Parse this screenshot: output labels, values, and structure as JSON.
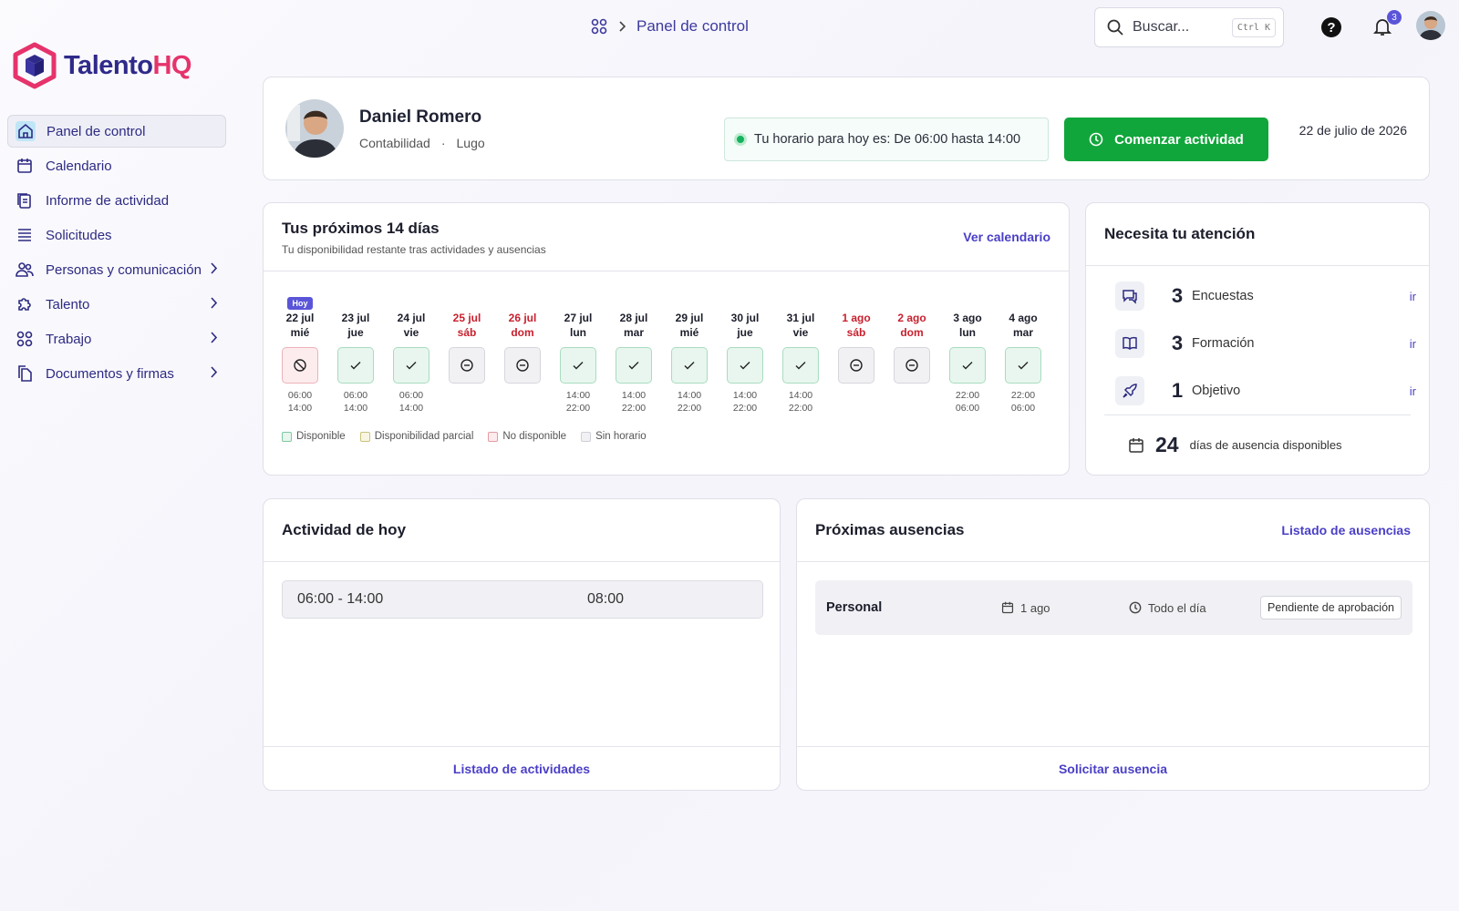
{
  "app": {
    "brand_part1": "Talento",
    "brand_part2": "HQ",
    "brand_color_primary": "#2f2a8a",
    "brand_color_accent": "#e6336b"
  },
  "header": {
    "breadcrumb_icon": "apps-grid-icon",
    "breadcrumb": "Panel de control",
    "search_placeholder": "Buscar...",
    "search_shortcut": "Ctrl K",
    "notifications_count": "3"
  },
  "sidebar": {
    "items": [
      {
        "label": "Panel de control",
        "icon": "home-icon",
        "active": true
      },
      {
        "label": "Calendario",
        "icon": "calendar-icon"
      },
      {
        "label": "Informe de actividad",
        "icon": "report-icon"
      },
      {
        "label": "Solicitudes",
        "icon": "list-icon"
      },
      {
        "label": "Personas y comunicación",
        "icon": "people-icon",
        "expandable": true
      },
      {
        "label": "Talento",
        "icon": "puzzle-icon",
        "expandable": true
      },
      {
        "label": "Trabajo",
        "icon": "grid-icon",
        "expandable": true
      },
      {
        "label": "Documentos y firmas",
        "icon": "documents-icon",
        "expandable": true
      }
    ]
  },
  "profile": {
    "name": "Daniel Romero",
    "department": "Contabilidad",
    "separator": "·",
    "location": "Lugo",
    "schedule_text": "Tu horario para hoy es: De 06:00 hasta 14:00",
    "start_button": "Comenzar actividad",
    "date": "22 de julio de 2026"
  },
  "days": {
    "title": "Tus próximos 14 días",
    "subtitle": "Tu disponibilidad restante tras actividades y ausencias",
    "link": "Ver calendario",
    "today_badge": "Hoy",
    "list": [
      {
        "date": "22 jul",
        "dow": "mié",
        "status": "no",
        "start": "06:00",
        "end": "14:00",
        "today": true
      },
      {
        "date": "23 jul",
        "dow": "jue",
        "status": "ok",
        "start": "06:00",
        "end": "14:00"
      },
      {
        "date": "24 jul",
        "dow": "vie",
        "status": "ok",
        "start": "06:00",
        "end": "14:00"
      },
      {
        "date": "25 jul",
        "dow": "sáb",
        "status": "none",
        "weekend": true
      },
      {
        "date": "26 jul",
        "dow": "dom",
        "status": "none",
        "weekend": true
      },
      {
        "date": "27 jul",
        "dow": "lun",
        "status": "ok",
        "start": "14:00",
        "end": "22:00"
      },
      {
        "date": "28 jul",
        "dow": "mar",
        "status": "ok",
        "start": "14:00",
        "end": "22:00"
      },
      {
        "date": "29 jul",
        "dow": "mié",
        "status": "ok",
        "start": "14:00",
        "end": "22:00"
      },
      {
        "date": "30 jul",
        "dow": "jue",
        "status": "ok",
        "start": "14:00",
        "end": "22:00"
      },
      {
        "date": "31 jul",
        "dow": "vie",
        "status": "ok",
        "start": "14:00",
        "end": "22:00"
      },
      {
        "date": "1 ago",
        "dow": "sáb",
        "status": "none",
        "weekend": true
      },
      {
        "date": "2 ago",
        "dow": "dom",
        "status": "none",
        "weekend": true
      },
      {
        "date": "3 ago",
        "dow": "lun",
        "status": "ok",
        "start": "22:00",
        "end": "06:00"
      },
      {
        "date": "4 ago",
        "dow": "mar",
        "status": "ok",
        "start": "22:00",
        "end": "06:00"
      }
    ],
    "legend": [
      {
        "label": "Disponible",
        "bg": "#e8f6ef",
        "border": "#7ec9a0"
      },
      {
        "label": "Disponibilidad parcial",
        "bg": "#f8f6e2",
        "border": "#c9c47a"
      },
      {
        "label": "No disponible",
        "bg": "#fdecee",
        "border": "#e59aa2"
      },
      {
        "label": "Sin horario",
        "bg": "#f1f1f4",
        "border": "#cfd0d8"
      }
    ]
  },
  "attention": {
    "title": "Necesita tu atención",
    "items": [
      {
        "count": "3",
        "label": "Encuestas",
        "icon": "chat-icon",
        "link": "ir"
      },
      {
        "count": "3",
        "label": "Formación",
        "icon": "book-icon",
        "link": "ir"
      },
      {
        "count": "1",
        "label": "Objetivo",
        "icon": "rocket-icon",
        "link": "ir"
      }
    ],
    "absence_days": "24",
    "absence_label": "días de ausencia disponibles"
  },
  "activity": {
    "title": "Actividad de hoy",
    "range": "06:00 - 14:00",
    "duration": "08:00",
    "footer_link": "Listado de actividades"
  },
  "absences": {
    "title": "Próximas ausencias",
    "list_link": "Listado de ausencias",
    "row": {
      "type": "Personal",
      "date": "1 ago",
      "duration": "Todo el día",
      "status": "Pendiente de aprobación"
    },
    "footer_link": "Solicitar ausencia"
  }
}
